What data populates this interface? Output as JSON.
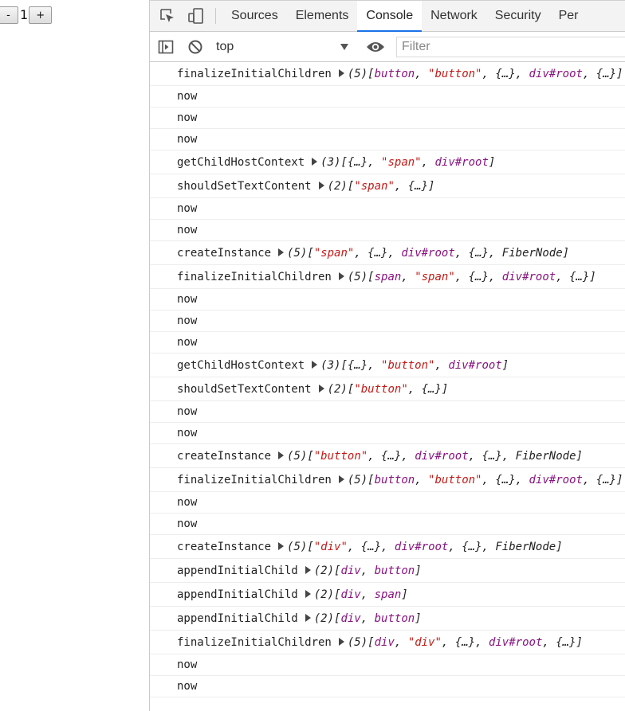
{
  "app": {
    "minus_label": "-",
    "count": "1",
    "plus_label": "+"
  },
  "devtools": {
    "tabs": [
      {
        "label": "Sources",
        "active": false
      },
      {
        "label": "Elements",
        "active": false
      },
      {
        "label": "Console",
        "active": true
      },
      {
        "label": "Network",
        "active": false
      },
      {
        "label": "Security",
        "active": false
      },
      {
        "label": "Per",
        "active": false
      }
    ],
    "toolbar": {
      "context": "top",
      "filter_placeholder": "Filter"
    },
    "icons": {
      "inspect": "inspect-element-icon",
      "device": "device-toggle-icon",
      "sidebar": "show-sidebar-icon",
      "clear": "clear-console-icon",
      "eye": "live-expression-eye-icon"
    },
    "colors": {
      "accent": "#1a73e8",
      "string": "#c41a16",
      "reference": "#881280"
    }
  },
  "console": {
    "lines": [
      {
        "fn": "finalizeInitialChildren",
        "count": "(5)",
        "parts": [
          [
            "p",
            "["
          ],
          [
            "r",
            "button"
          ],
          [
            "p",
            ", "
          ],
          [
            "s",
            "\"button\""
          ],
          [
            "p",
            ", {…}, "
          ],
          [
            "r",
            "div#root"
          ],
          [
            "p",
            ", {…}]"
          ]
        ]
      },
      {
        "fn": "now"
      },
      {
        "fn": "now"
      },
      {
        "fn": "now"
      },
      {
        "fn": "getChildHostContext",
        "count": "(3)",
        "parts": [
          [
            "p",
            "[{…}, "
          ],
          [
            "s",
            "\"span\""
          ],
          [
            "p",
            ", "
          ],
          [
            "r",
            "div#root"
          ],
          [
            "p",
            "]"
          ]
        ]
      },
      {
        "fn": "shouldSetTextContent",
        "count": "(2)",
        "parts": [
          [
            "p",
            "["
          ],
          [
            "s",
            "\"span\""
          ],
          [
            "p",
            ", {…}]"
          ]
        ]
      },
      {
        "fn": "now"
      },
      {
        "fn": "now"
      },
      {
        "fn": "createInstance",
        "count": "(5)",
        "parts": [
          [
            "p",
            "["
          ],
          [
            "s",
            "\"span\""
          ],
          [
            "p",
            ", {…}, "
          ],
          [
            "r",
            "div#root"
          ],
          [
            "p",
            ", {…}, FiberNode]"
          ]
        ]
      },
      {
        "fn": "finalizeInitialChildren",
        "count": "(5)",
        "parts": [
          [
            "p",
            "["
          ],
          [
            "r",
            "span"
          ],
          [
            "p",
            ", "
          ],
          [
            "s",
            "\"span\""
          ],
          [
            "p",
            ", {…}, "
          ],
          [
            "r",
            "div#root"
          ],
          [
            "p",
            ", {…}]"
          ]
        ]
      },
      {
        "fn": "now"
      },
      {
        "fn": "now"
      },
      {
        "fn": "now"
      },
      {
        "fn": "getChildHostContext",
        "count": "(3)",
        "parts": [
          [
            "p",
            "[{…}, "
          ],
          [
            "s",
            "\"button\""
          ],
          [
            "p",
            ", "
          ],
          [
            "r",
            "div#root"
          ],
          [
            "p",
            "]"
          ]
        ]
      },
      {
        "fn": "shouldSetTextContent",
        "count": "(2)",
        "parts": [
          [
            "p",
            "["
          ],
          [
            "s",
            "\"button\""
          ],
          [
            "p",
            ", {…}]"
          ]
        ]
      },
      {
        "fn": "now"
      },
      {
        "fn": "now"
      },
      {
        "fn": "createInstance",
        "count": "(5)",
        "parts": [
          [
            "p",
            "["
          ],
          [
            "s",
            "\"button\""
          ],
          [
            "p",
            ", {…}, "
          ],
          [
            "r",
            "div#root"
          ],
          [
            "p",
            ", {…}, FiberNode]"
          ]
        ]
      },
      {
        "fn": "finalizeInitialChildren",
        "count": "(5)",
        "parts": [
          [
            "p",
            "["
          ],
          [
            "r",
            "button"
          ],
          [
            "p",
            ", "
          ],
          [
            "s",
            "\"button\""
          ],
          [
            "p",
            ", {…}, "
          ],
          [
            "r",
            "div#root"
          ],
          [
            "p",
            ", {…}]"
          ]
        ]
      },
      {
        "fn": "now"
      },
      {
        "fn": "now"
      },
      {
        "fn": "createInstance",
        "count": "(5)",
        "parts": [
          [
            "p",
            "["
          ],
          [
            "s",
            "\"div\""
          ],
          [
            "p",
            ", {…}, "
          ],
          [
            "r",
            "div#root"
          ],
          [
            "p",
            ", {…}, FiberNode]"
          ]
        ]
      },
      {
        "fn": "appendInitialChild",
        "count": "(2)",
        "parts": [
          [
            "p",
            "["
          ],
          [
            "r",
            "div"
          ],
          [
            "p",
            ", "
          ],
          [
            "r",
            "button"
          ],
          [
            "p",
            "]"
          ]
        ]
      },
      {
        "fn": "appendInitialChild",
        "count": "(2)",
        "parts": [
          [
            "p",
            "["
          ],
          [
            "r",
            "div"
          ],
          [
            "p",
            ", "
          ],
          [
            "r",
            "span"
          ],
          [
            "p",
            "]"
          ]
        ]
      },
      {
        "fn": "appendInitialChild",
        "count": "(2)",
        "parts": [
          [
            "p",
            "["
          ],
          [
            "r",
            "div"
          ],
          [
            "p",
            ", "
          ],
          [
            "r",
            "button"
          ],
          [
            "p",
            "]"
          ]
        ]
      },
      {
        "fn": "finalizeInitialChildren",
        "count": "(5)",
        "parts": [
          [
            "p",
            "["
          ],
          [
            "r",
            "div"
          ],
          [
            "p",
            ", "
          ],
          [
            "s",
            "\"div\""
          ],
          [
            "p",
            ", {…}, "
          ],
          [
            "r",
            "div#root"
          ],
          [
            "p",
            ", {…}]"
          ]
        ]
      },
      {
        "fn": "now"
      },
      {
        "fn": "now"
      }
    ]
  }
}
